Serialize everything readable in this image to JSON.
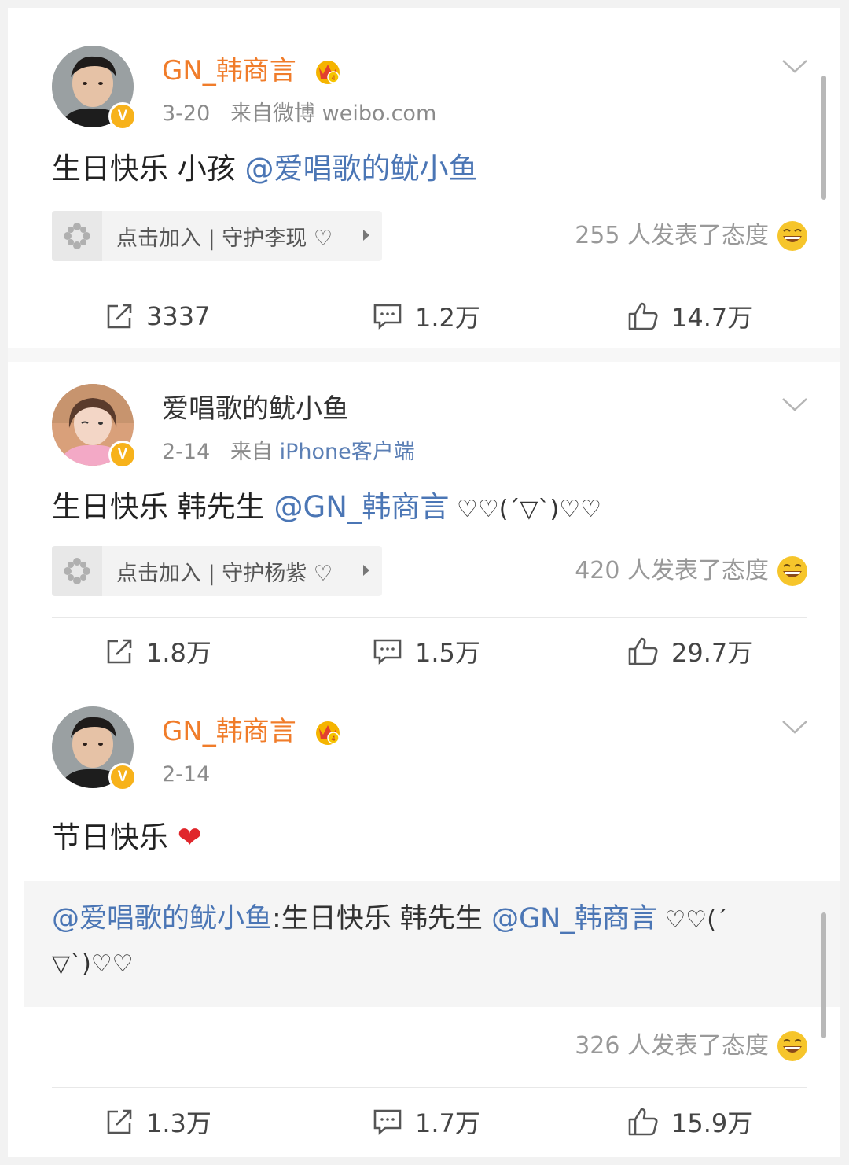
{
  "posts": [
    {
      "username": "GN_韩商言",
      "date": "3-20",
      "source_prefix": "来自微博",
      "source": "weibo.com",
      "text": "生日快乐 小孩 ",
      "mention": "@爱唱歌的鱿小鱼",
      "join_label": "点击加入 | 守护李现 ♡",
      "reaction_text": "255 人发表了态度",
      "reposts": "3337",
      "comments": "1.2万",
      "likes": "14.7万"
    },
    {
      "username": "爱唱歌的鱿小鱼",
      "date": "2-14",
      "source_prefix": "来自",
      "source": "iPhone客户端",
      "text": "生日快乐 韩先生 ",
      "mention": "@GN_韩商言",
      "emoticon": " ♡♡(´▽`)♡♡",
      "join_label": "点击加入 | 守护杨紫 ♡",
      "reaction_text": "420 人发表了态度",
      "reposts": "1.8万",
      "comments": "1.5万",
      "likes": "29.7万"
    },
    {
      "username": "GN_韩商言",
      "date": "2-14",
      "text": "节日快乐 ",
      "heart": "❤",
      "quote": {
        "mention": "@爱唱歌的鱿小鱼",
        "text": ":生日快乐 韩先生 ",
        "mention2": "@GN_韩商言",
        "emoticon1": " ♡♡(´",
        "emoticon2": "▽`)♡♡"
      },
      "reaction_text": "326 人发表了态度",
      "reposts": "1.3万",
      "comments": "1.7万",
      "likes": "15.9万"
    }
  ],
  "colors": {
    "vip_name": "#f07c2a",
    "link": "#4b76b5",
    "badge": "#f7b21b"
  },
  "icons": [
    "crown-vip-icon",
    "verified-badge-icon",
    "chevron-down-icon",
    "join-fan-icon",
    "smiley-icon",
    "repost-icon",
    "comment-icon",
    "like-icon"
  ]
}
